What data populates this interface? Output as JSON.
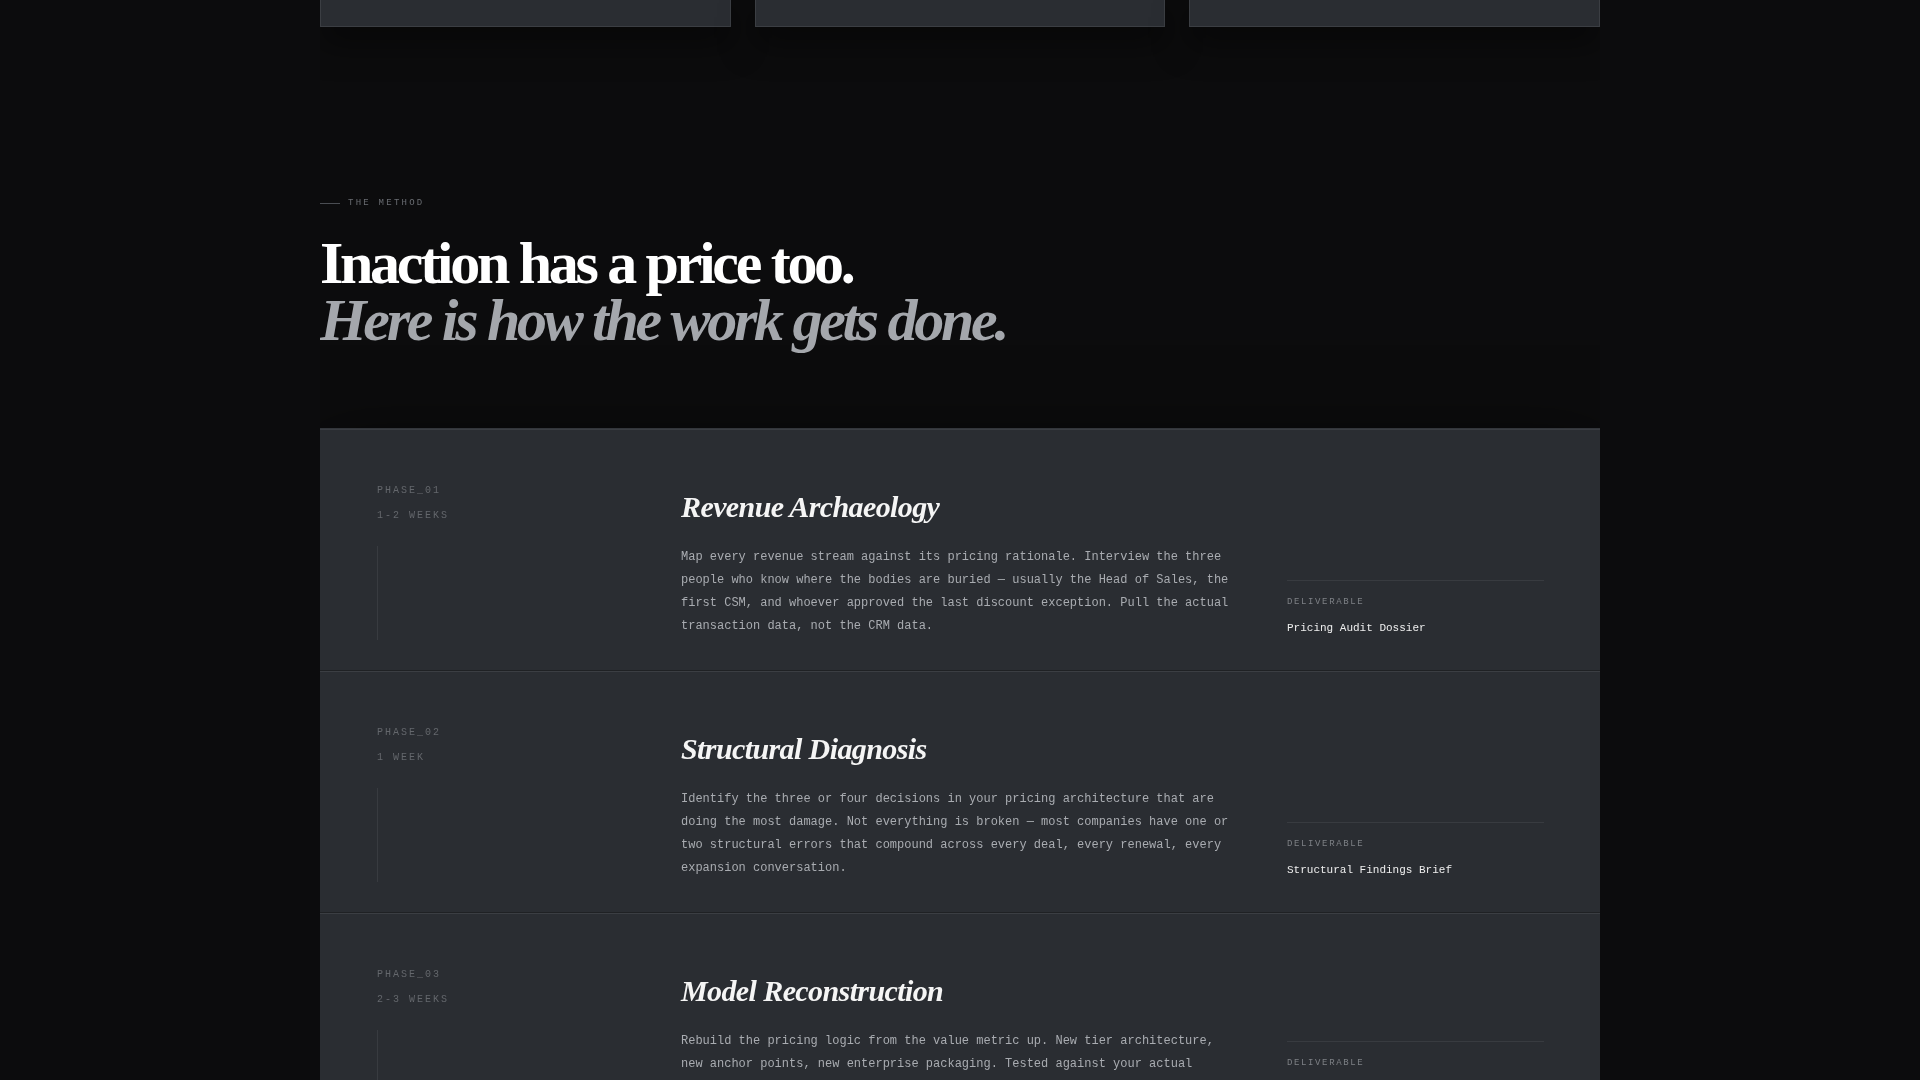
{
  "section": {
    "eyebrow": "THE METHOD",
    "heading": "Inaction has a price too.",
    "subheading": "Here is how the work gets done."
  },
  "phases": [
    {
      "phase": "PHASE_01",
      "duration": "1-2 WEEKS",
      "title": "Revenue Archaeology",
      "description": "Map every revenue stream against its pricing rationale. Interview the three people who know where the bodies are buried — usually the Head of Sales, the first CSM, and whoever approved the last discount exception. Pull the actual transaction data, not the CRM data.",
      "deliverable_label": "DELIVERABLE",
      "deliverable": "Pricing Audit Dossier"
    },
    {
      "phase": "PHASE_02",
      "duration": "1 WEEK",
      "title": "Structural Diagnosis",
      "description": "Identify the three or four decisions in your pricing architecture that are doing the most damage. Not everything is broken — most companies have one or two structural errors that compound across every deal, every renewal, every expansion conversation.",
      "deliverable_label": "DELIVERABLE",
      "deliverable": "Structural Findings Brief"
    },
    {
      "phase": "PHASE_03",
      "duration": "2-3 WEEKS",
      "title": "Model Reconstruction",
      "description": "Rebuild the pricing logic from the value metric up. New tier architecture, new anchor points, new enterprise packaging. Tested against your actual",
      "deliverable_label": "DELIVERABLE"
    }
  ]
}
